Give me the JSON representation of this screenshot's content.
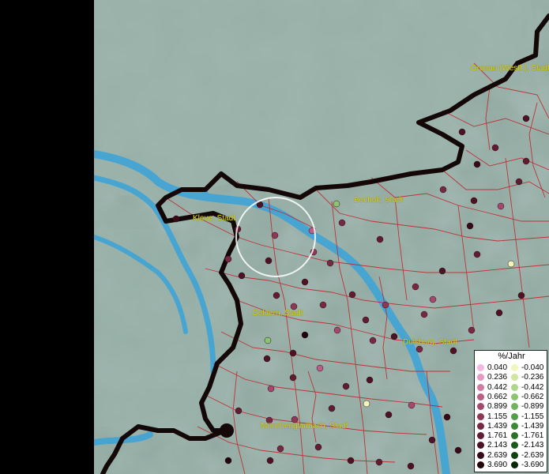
{
  "cities": [
    {
      "name": "Gronau (Westf.), Stadt"
    },
    {
      "name": "Bocholt, Stadt"
    },
    {
      "name": "Kleve, Stadt"
    },
    {
      "name": "Geldern, Stadt"
    },
    {
      "name": "Duisburg, Stadt"
    },
    {
      "name": "Mönchengladbach, Stadt"
    }
  ],
  "legend": {
    "title": "%/Jahr",
    "positive": [
      {
        "label": "0.040",
        "color": "#f4b8e2"
      },
      {
        "label": "0.236",
        "color": "#e59ac3"
      },
      {
        "label": "0.442",
        "color": "#d17aa2"
      },
      {
        "label": "0.662",
        "color": "#bb5e85"
      },
      {
        "label": "0.899",
        "color": "#a4486d"
      },
      {
        "label": "1.155",
        "color": "#8e3757"
      },
      {
        "label": "1.439",
        "color": "#772843"
      },
      {
        "label": "1.761",
        "color": "#621c32"
      },
      {
        "label": "2.143",
        "color": "#4d1224"
      },
      {
        "label": "2.639",
        "color": "#370a17"
      },
      {
        "label": "3.690",
        "color": "#22040b"
      }
    ],
    "negative": [
      {
        "label": "-0.040",
        "color": "#f1f7b9"
      },
      {
        "label": "-0.236",
        "color": "#cfe7a0"
      },
      {
        "label": "-0.442",
        "color": "#aed688"
      },
      {
        "label": "-0.662",
        "color": "#8dc471"
      },
      {
        "label": "-0.899",
        "color": "#6fb35c"
      },
      {
        "label": "-1.155",
        "color": "#539f48"
      },
      {
        "label": "-1.439",
        "color": "#3c8a36"
      },
      {
        "label": "-1.761",
        "color": "#2a7326"
      },
      {
        "label": "-2.143",
        "color": "#1b5a18"
      },
      {
        "label": "-2.639",
        "color": "#10410e"
      },
      {
        "label": "-3.690",
        "color": "#082807"
      }
    ]
  },
  "colors": {
    "terrain": "#8fa8a0",
    "water": "#3aa3d9",
    "border": "#1a0a0a",
    "municipal_lines": "#c0262c",
    "label_text": "#ddd500"
  }
}
